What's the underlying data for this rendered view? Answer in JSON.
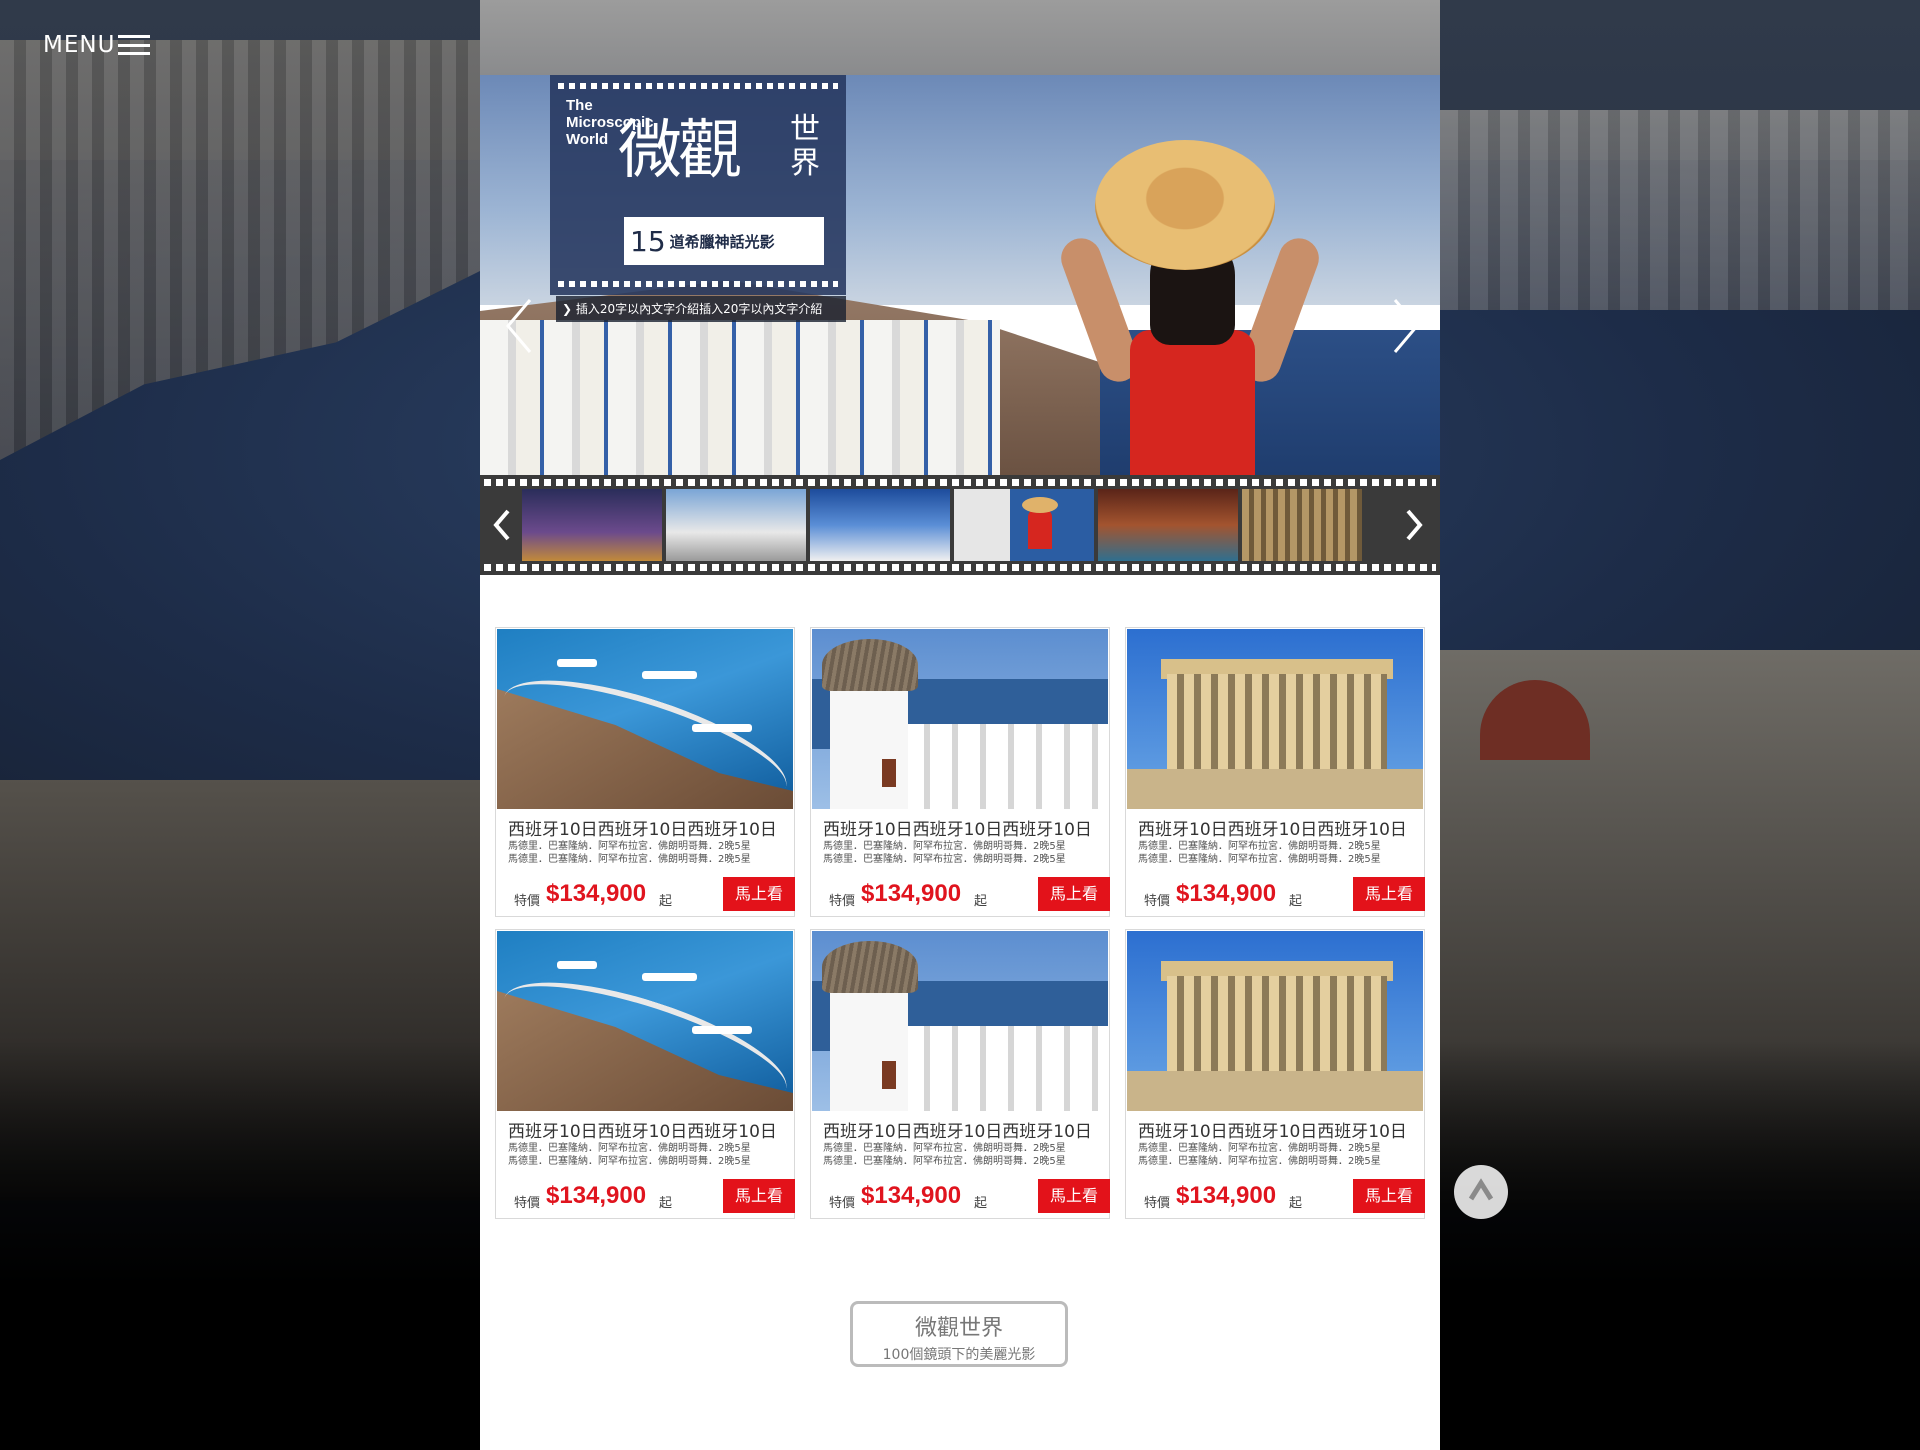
{
  "menu": {
    "label": "MENU",
    "icon": "hamburger-icon"
  },
  "hero": {
    "title_en": "The\nMicroscopic\nWorld",
    "title_cn_big": "微觀",
    "title_cn_small": "世界",
    "subtitle_num": "15",
    "subtitle_text": "道希臘神話光影",
    "caption": "插入20字以內文字介紹插入20字以內文字介紹",
    "prev_icon": "chevron-left-icon",
    "next_icon": "chevron-right-icon"
  },
  "filmstrip": {
    "thumbnails": [
      "night-city",
      "white-church",
      "blue-dome",
      "red-dress-woman",
      "rocky-coast",
      "temple-columns"
    ],
    "prev_icon": "chevron-left-icon",
    "next_icon": "chevron-right-icon"
  },
  "products": [
    {
      "photo": "stairs",
      "title": "西班牙10日西班牙10日西班牙10日",
      "desc1": "馬德里．巴塞隆納．阿罕布拉宮．佛朗明哥舞．2晚5星",
      "desc2": "馬德里．巴塞隆納．阿罕布拉宮．佛朗明哥舞．2晚5星",
      "price_label": "特價",
      "price": "$134,900",
      "price_suffix": "起",
      "button": "馬上看"
    },
    {
      "photo": "windmill",
      "title": "西班牙10日西班牙10日西班牙10日",
      "desc1": "馬德里．巴塞隆納．阿罕布拉宮．佛朗明哥舞．2晚5星",
      "desc2": "馬德里．巴塞隆納．阿罕布拉宮．佛朗明哥舞．2晚5星",
      "price_label": "特價",
      "price": "$134,900",
      "price_suffix": "起",
      "button": "馬上看"
    },
    {
      "photo": "parthenon",
      "title": "西班牙10日西班牙10日西班牙10日",
      "desc1": "馬德里．巴塞隆納．阿罕布拉宮．佛朗明哥舞．2晚5星",
      "desc2": "馬德里．巴塞隆納．阿罕布拉宮．佛朗明哥舞．2晚5星",
      "price_label": "特價",
      "price": "$134,900",
      "price_suffix": "起",
      "button": "馬上看"
    },
    {
      "photo": "stairs",
      "title": "西班牙10日西班牙10日西班牙10日",
      "desc1": "馬德里．巴塞隆納．阿罕布拉宮．佛朗明哥舞．2晚5星",
      "desc2": "馬德里．巴塞隆納．阿罕布拉宮．佛朗明哥舞．2晚5星",
      "price_label": "特價",
      "price": "$134,900",
      "price_suffix": "起",
      "button": "馬上看"
    },
    {
      "photo": "windmill",
      "title": "西班牙10日西班牙10日西班牙10日",
      "desc1": "馬德里．巴塞隆納．阿罕布拉宮．佛朗明哥舞．2晚5星",
      "desc2": "馬德里．巴塞隆納．阿罕布拉宮．佛朗明哥舞．2晚5星",
      "price_label": "特價",
      "price": "$134,900",
      "price_suffix": "起",
      "button": "馬上看"
    },
    {
      "photo": "parthenon",
      "title": "西班牙10日西班牙10日西班牙10日",
      "desc1": "馬德里．巴塞隆納．阿罕布拉宮．佛朗明哥舞．2晚5星",
      "desc2": "馬德里．巴塞隆納．阿罕布拉宮．佛朗明哥舞．2晚5星",
      "price_label": "特價",
      "price": "$134,900",
      "price_suffix": "起",
      "button": "馬上看"
    }
  ],
  "footer_button": {
    "line1": "微觀世界",
    "line2": "100個鏡頭下的美麗光影"
  },
  "back_to_top_icon": "arrow-up-icon",
  "colors": {
    "accent_red": "#e3121a",
    "price_red": "#e0141e",
    "title_box": "#26375e"
  }
}
